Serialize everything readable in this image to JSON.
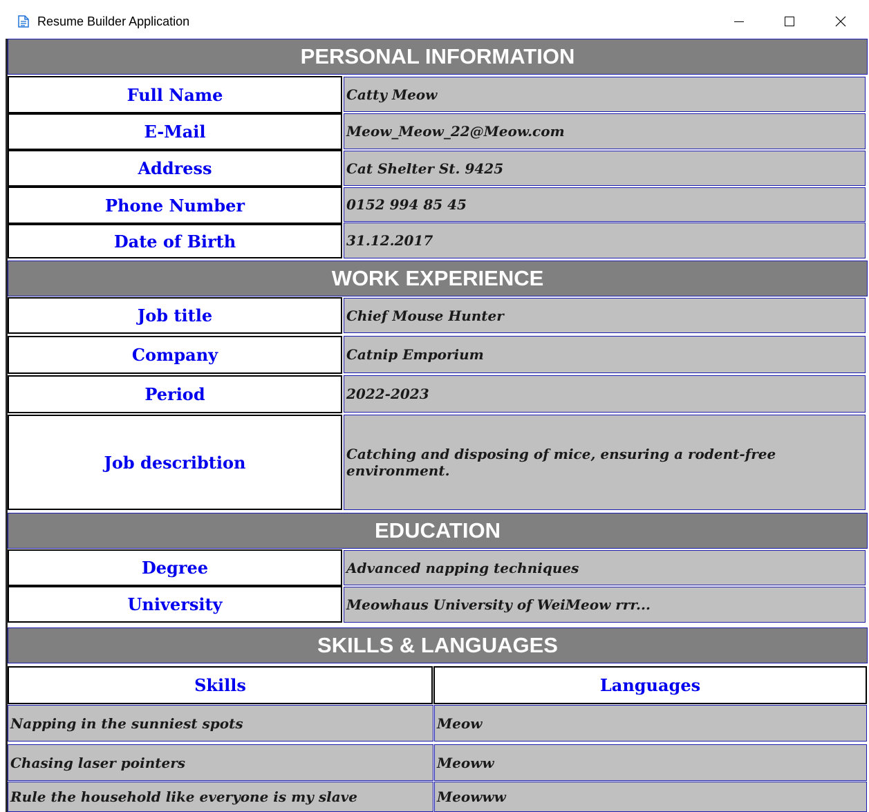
{
  "window": {
    "title": "Resume Builder Application",
    "icon": "document-icon",
    "controls": [
      "minimize-icon",
      "maximize-icon",
      "close-icon"
    ]
  },
  "personal": {
    "header": "PERSONAL INFORMATION",
    "rows": [
      {
        "label": "Full Name",
        "value": "Catty Meow"
      },
      {
        "label": "E-Mail",
        "value": "Meow_Meow_22@Meow.com"
      },
      {
        "label": "Address",
        "value": "Cat Shelter  St. 9425"
      },
      {
        "label": "Phone Number",
        "value": "0152 994 85 45"
      },
      {
        "label": "Date of Birth",
        "value": "31.12.2017"
      }
    ]
  },
  "work": {
    "header": "WORK EXPERIENCE",
    "rows": [
      {
        "label": "Job title",
        "value": "Chief Mouse Hunter"
      },
      {
        "label": "Company",
        "value": "Catnip Emporium"
      },
      {
        "label": "Period",
        "value": "2022-2023"
      },
      {
        "label": "Job describtion",
        "value": "Catching and disposing of mice, ensuring a rodent-free environment."
      }
    ]
  },
  "education": {
    "header": "EDUCATION",
    "rows": [
      {
        "label": "Degree",
        "value": "Advanced napping techniques"
      },
      {
        "label": "University",
        "value": "Meowhaus University of WeiMeow rrr..."
      }
    ]
  },
  "skills": {
    "header": "SKILLS & LANGUAGES",
    "skills_label": "Skills",
    "languages_label": "Languages",
    "skills": [
      "Napping in the sunniest spots",
      "Chasing laser pointers",
      "Rule the household like everyone is my slave"
    ],
    "languages": [
      "Meow",
      "Meoww",
      "Meowww"
    ]
  },
  "colors": {
    "header_bg": "#808080",
    "value_bg": "#c0c0c0",
    "label_text": "#0000ee",
    "border_blue": "#1c1cae"
  }
}
